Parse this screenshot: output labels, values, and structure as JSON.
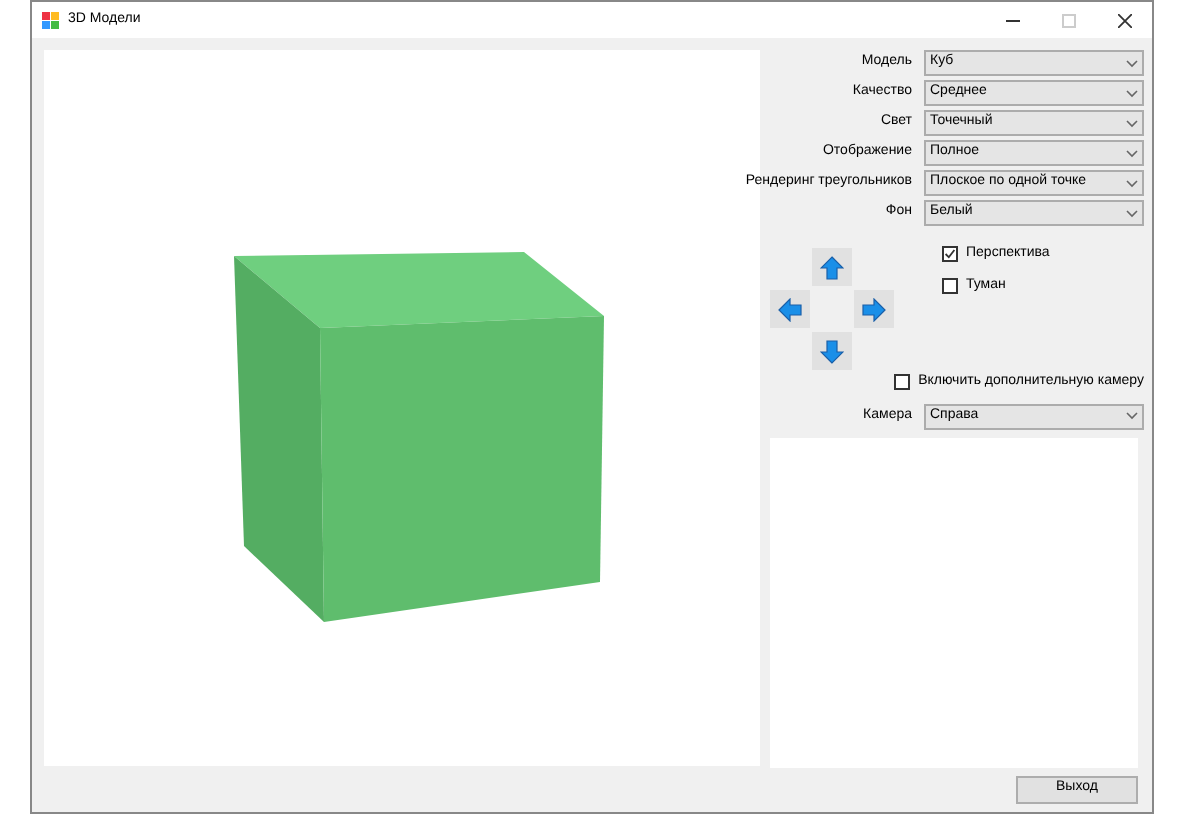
{
  "window": {
    "title": "3D Модели"
  },
  "settings": [
    {
      "label": "Модель",
      "value": "Куб"
    },
    {
      "label": "Качество",
      "value": "Среднее"
    },
    {
      "label": "Свет",
      "value": "Точечный"
    },
    {
      "label": "Отображение",
      "value": "Полное"
    },
    {
      "label": "Рендеринг треугольников",
      "value": "Плоское по одной точке"
    },
    {
      "label": "Фон",
      "value": "Белый"
    }
  ],
  "options": [
    {
      "label": "Перспектива",
      "checked": true
    },
    {
      "label": "Туман",
      "checked": false
    }
  ],
  "extra_camera": {
    "label": "Включить дополнительную камеру",
    "checked": false
  },
  "camera": {
    "label": "Камера",
    "value": "Справа"
  },
  "exit_button": "Выход"
}
